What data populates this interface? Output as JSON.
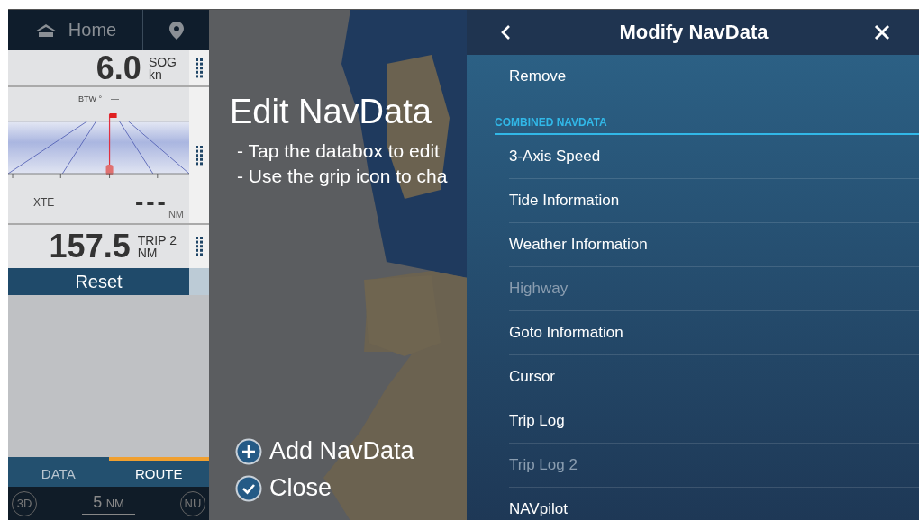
{
  "header": {
    "title": "Home"
  },
  "databoxes": [
    {
      "kind": "speed",
      "value": "6.0",
      "label": "SOG",
      "unit": "kn"
    },
    {
      "kind": "highway",
      "btw_label": "BTW °",
      "btw_value": "—",
      "xte_label": "XTE",
      "xte_value": "---",
      "xte_unit": "NM"
    },
    {
      "kind": "trip",
      "value": "157.5",
      "label": "TRIP 2",
      "unit": "NM",
      "button": "Reset"
    }
  ],
  "tabs": [
    {
      "label": "DATA",
      "selected": false
    },
    {
      "label": "ROUTE",
      "selected": true
    }
  ],
  "bottom_bar": {
    "view_mode": "3D",
    "range_value": "5",
    "range_unit": "NM",
    "orientation": "NU"
  },
  "overlay": {
    "title": "Edit NavData",
    "instructions": [
      "- Tap the databox to edit",
      "- Use the grip icon to cha"
    ],
    "actions": [
      {
        "kind": "add",
        "label": "Add NavData"
      },
      {
        "kind": "close",
        "label": "Close"
      }
    ]
  },
  "panel": {
    "title": "Modify NavData",
    "top_items": [
      {
        "label": "Remove",
        "disabled": false
      }
    ],
    "section": "COMBINED NAVDATA",
    "items": [
      {
        "label": "3-Axis Speed",
        "disabled": false
      },
      {
        "label": "Tide Information",
        "disabled": false
      },
      {
        "label": "Weather Information",
        "disabled": false
      },
      {
        "label": "Highway",
        "disabled": true
      },
      {
        "label": "Goto Information",
        "disabled": false
      },
      {
        "label": "Cursor",
        "disabled": false
      },
      {
        "label": "Trip Log",
        "disabled": false
      },
      {
        "label": "Trip Log 2",
        "disabled": true
      },
      {
        "label": "NAVpilot",
        "disabled": false
      }
    ]
  }
}
